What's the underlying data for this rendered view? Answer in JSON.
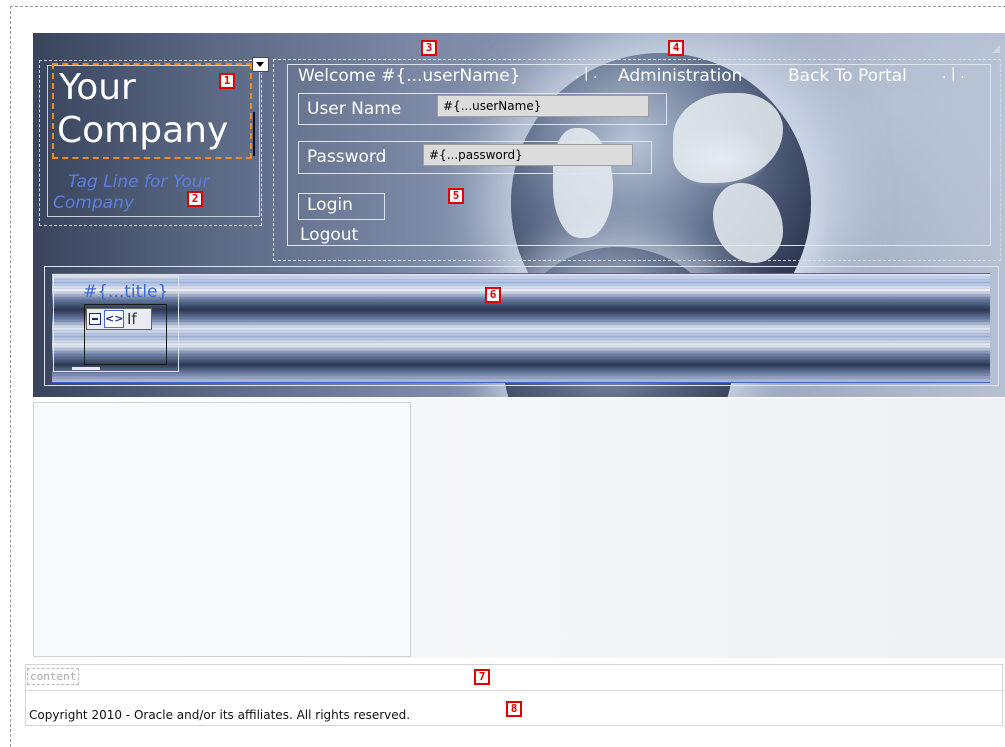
{
  "logo": {
    "line1": "Your",
    "line2": "Company",
    "tagline": "Tag Line for Your Company"
  },
  "header": {
    "welcome": "Welcome #{...userName}",
    "nav_admin": "Administration",
    "nav_portal": "Back To Portal",
    "nav_sep": ". | .",
    "username_label": "User Name",
    "username_value": "#{...userName}",
    "password_label": "Password",
    "password_value": "#{...password}",
    "login_label": "Login",
    "logout_label": "Logout"
  },
  "band": {
    "title": "#{...title}",
    "if_label": "If"
  },
  "markers": [
    "1",
    "2",
    "3",
    "4",
    "5",
    "6",
    "7",
    "8"
  ],
  "content": {
    "facet_label": "content"
  },
  "footer": {
    "copyright": "Copyright 2010 - Oracle and/or its affiliates. All rights reserved."
  },
  "colors": {
    "accent": "#3c68d8",
    "marker": "#e00000",
    "tagline": "#5d7ee0"
  },
  "icons": {
    "dropdown": "dropdown-arrow-icon",
    "resize": "resize-handle-icon",
    "collapse": "collapse-box-icon",
    "code": "code-tag-icon"
  }
}
